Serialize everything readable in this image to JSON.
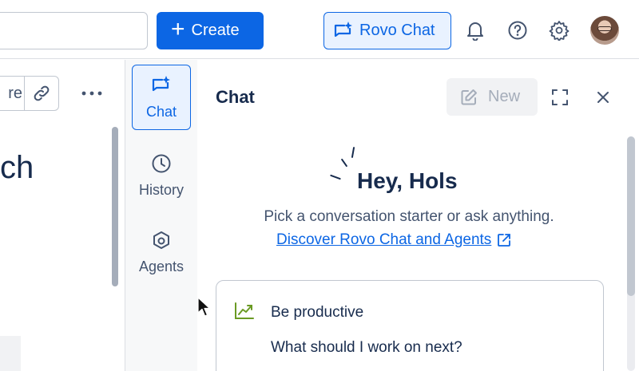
{
  "topbar": {
    "search": {
      "placeholder": ""
    },
    "create_label": "Create",
    "rovo_chat_label": "Rovo Chat",
    "icons": [
      "bell-icon",
      "help-icon",
      "gear-icon"
    ],
    "accent": "#0c66e4"
  },
  "page": {
    "share_fragment": "re",
    "heading_fragment": "ch"
  },
  "rail": {
    "items": [
      {
        "label": "Chat",
        "icon": "chat-sparkle-icon",
        "active": true
      },
      {
        "label": "History",
        "icon": "clock-icon",
        "active": false
      },
      {
        "label": "Agents",
        "icon": "agents-icon",
        "active": false
      }
    ]
  },
  "chat": {
    "title": "Chat",
    "new_label": "New",
    "greeting": "Hey, Hols",
    "subtext": "Pick a conversation starter or ask anything.",
    "discover_link": "Discover Rovo Chat and Agents",
    "starter": {
      "title": "Be productive",
      "prompt": "What should I work on next?",
      "icon": "trend-up-icon",
      "icon_color": "#6a9a23"
    }
  }
}
